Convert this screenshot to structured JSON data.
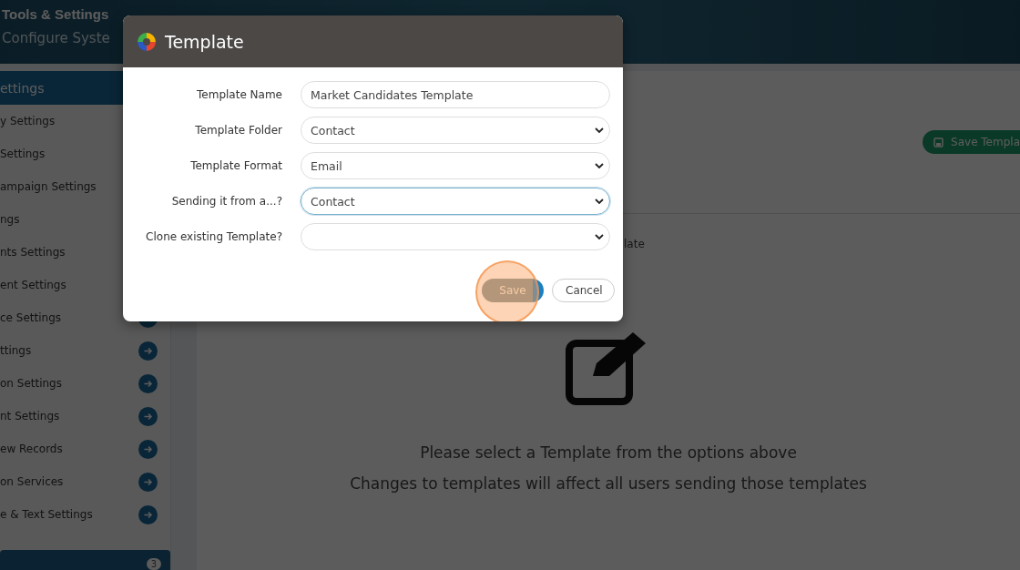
{
  "header": {
    "title": "Tools & Settings",
    "subtitle": "Configure Syste"
  },
  "sidebar": {
    "title": "ettings",
    "items": [
      {
        "label": "y Settings"
      },
      {
        "label": "Settings"
      },
      {
        "label": "ampaign Settings"
      },
      {
        "label": "ngs"
      },
      {
        "label": "nts Settings"
      },
      {
        "label": "ent Settings"
      },
      {
        "label": "ce Settings",
        "arrow": true
      },
      {
        "label": "ttings",
        "arrow": true
      },
      {
        "label": "on Settings",
        "arrow": true
      },
      {
        "label": "nt Settings",
        "arrow": true
      },
      {
        "label": "ew Records",
        "arrow": true
      },
      {
        "label": "on Services",
        "arrow": true
      },
      {
        "label": "e & Text Settings",
        "arrow": true
      }
    ],
    "footer_badge": "3"
  },
  "main": {
    "save_button": "Save Templa",
    "option_fragment": "late",
    "empty_title": "Please select a Template from the options above",
    "empty_note": "Changes to templates will affect all users sending those templates"
  },
  "dialog": {
    "title": "Template",
    "fields": [
      {
        "label": "Template Name",
        "kind": "text",
        "value": "Market Candidates Template",
        "focused": false
      },
      {
        "label": "Template Folder",
        "kind": "select",
        "value": "Contact",
        "focused": false
      },
      {
        "label": "Template Format",
        "kind": "select",
        "value": "Email",
        "focused": false
      },
      {
        "label": "Sending it from a...?",
        "kind": "select",
        "value": "Contact",
        "focused": true
      },
      {
        "label": "Clone existing Template?",
        "kind": "select",
        "focused": false
      }
    ],
    "buttons": [
      {
        "label": "Save",
        "kind": "primary",
        "highlighted": true
      },
      {
        "label": "Cancel",
        "kind": "secondary",
        "highlighted": false
      }
    ]
  }
}
